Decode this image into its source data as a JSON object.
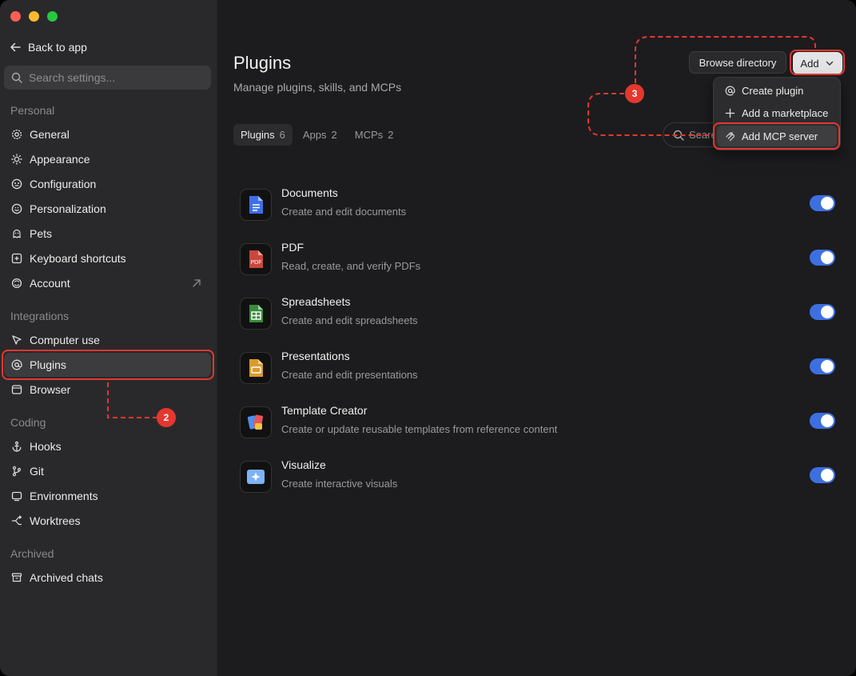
{
  "sidebar": {
    "back_label": "Back to app",
    "search_placeholder": "Search settings...",
    "sections": {
      "personal": "Personal",
      "integrations": "Integrations",
      "coding": "Coding",
      "archived": "Archived"
    },
    "items": {
      "general": "General",
      "appearance": "Appearance",
      "configuration": "Configuration",
      "personalization": "Personalization",
      "pets": "Pets",
      "keyboard_shortcuts": "Keyboard shortcuts",
      "account": "Account",
      "computer_use": "Computer use",
      "plugins": "Plugins",
      "browser": "Browser",
      "hooks": "Hooks",
      "git": "Git",
      "environments": "Environments",
      "worktrees": "Worktrees",
      "archived_chats": "Archived chats"
    },
    "active_item": "plugins"
  },
  "main": {
    "title": "Plugins",
    "subtitle": "Manage plugins, skills, and MCPs",
    "browse_label": "Browse directory",
    "add_label": "Add",
    "search_placeholder": "Search",
    "tabs": [
      {
        "label": "Plugins",
        "count": "6"
      },
      {
        "label": "Apps",
        "count": "2"
      },
      {
        "label": "MCPs",
        "count": "2"
      }
    ],
    "plugins": [
      {
        "name": "Documents",
        "desc": "Create and edit documents",
        "enabled": true,
        "icon": "document-icon"
      },
      {
        "name": "PDF",
        "desc": "Read, create, and verify PDFs",
        "enabled": true,
        "icon": "pdf-icon"
      },
      {
        "name": "Spreadsheets",
        "desc": "Create and edit spreadsheets",
        "enabled": true,
        "icon": "spreadsheet-icon"
      },
      {
        "name": "Presentations",
        "desc": "Create and edit presentations",
        "enabled": true,
        "icon": "presentation-icon"
      },
      {
        "name": "Template Creator",
        "desc": "Create or update reusable templates from reference content",
        "enabled": true,
        "icon": "template-icon"
      },
      {
        "name": "Visualize",
        "desc": "Create interactive visuals",
        "enabled": true,
        "icon": "visualize-icon"
      }
    ],
    "pdf_icon_text": "PDF",
    "add_menu": {
      "items": [
        "Create plugin",
        "Add a marketplace",
        "Add MCP server"
      ],
      "highlighted": "Add MCP server"
    }
  },
  "annotations": {
    "step2": "2",
    "step3": "3"
  },
  "colors": {
    "accent_toggle": "#3e6fe0",
    "annotation_red": "#e5372e"
  }
}
